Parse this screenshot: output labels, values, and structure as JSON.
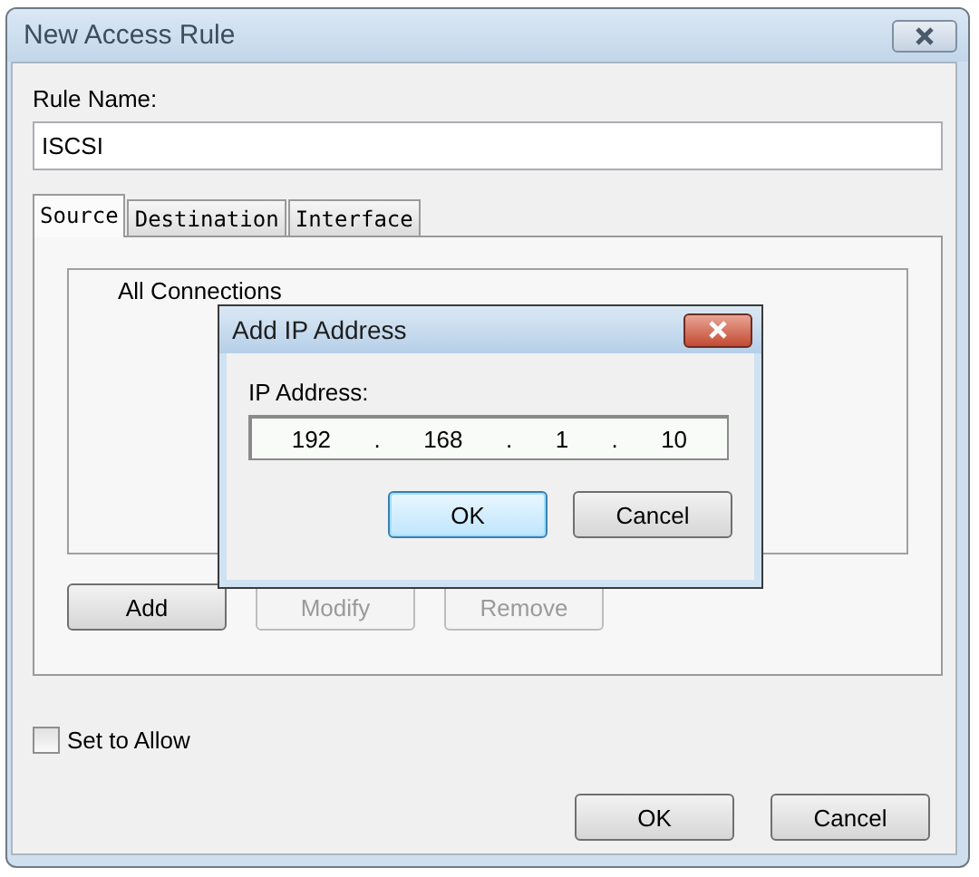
{
  "window": {
    "title": "New Access Rule"
  },
  "rule_name": {
    "label": "Rule Name:",
    "value": "ISCSI"
  },
  "tabs": [
    {
      "label": "Source",
      "selected": true
    },
    {
      "label": "Destination",
      "selected": false
    },
    {
      "label": "Interface",
      "selected": false
    }
  ],
  "list": {
    "items": [
      "All Connections"
    ]
  },
  "list_buttons": [
    {
      "label": "Add",
      "disabled": false
    },
    {
      "label": "Modify",
      "disabled": true
    },
    {
      "label": "Remove",
      "disabled": true
    }
  ],
  "allow": {
    "label": "Set to Allow",
    "checked": false
  },
  "buttons": [
    {
      "label": "OK",
      "default": false
    },
    {
      "label": "Cancel",
      "default": false
    }
  ],
  "dialog": {
    "title": "Add IP Address",
    "label": "IP Address:",
    "octets": [
      "192",
      "168",
      "1",
      "10"
    ],
    "separator": ".",
    "buttons": [
      {
        "label": "OK",
        "default": true
      },
      {
        "label": "Cancel",
        "default": false
      }
    ]
  }
}
